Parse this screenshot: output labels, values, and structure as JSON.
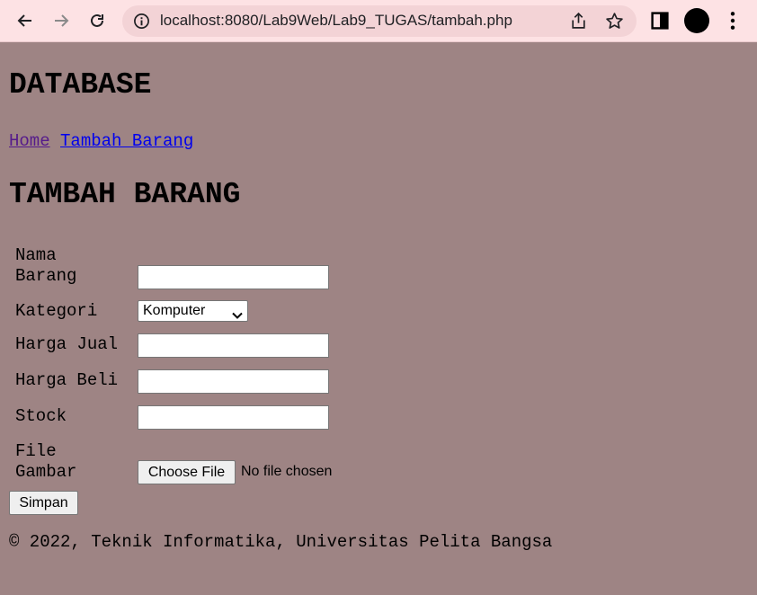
{
  "browser": {
    "url": "localhost:8080/Lab9Web/Lab9_TUGAS/tambah.php"
  },
  "header": {
    "title": "DATABASE"
  },
  "nav": {
    "items": [
      {
        "label": "Home"
      },
      {
        "label": "Tambah Barang"
      }
    ]
  },
  "main": {
    "heading": "TAMBAH BARANG",
    "form": {
      "nama_label_line1": "Nama",
      "nama_label_line2": "Barang",
      "nama_value": "",
      "kategori_label": "Kategori",
      "kategori_selected": "Komputer",
      "harga_jual_label": "Harga Jual",
      "harga_jual_value": "",
      "harga_beli_label": "Harga Beli",
      "harga_beli_value": "",
      "stock_label": "Stock",
      "stock_value": "",
      "gambar_label_line1": "File",
      "gambar_label_line2": "Gambar",
      "file_button_label": "Choose File",
      "file_status": "No file chosen",
      "submit_label": "Simpan"
    }
  },
  "footer": {
    "text": "© 2022, Teknik Informatika, Universitas Pelita Bangsa"
  },
  "colors": {
    "page_background": "#9e8484",
    "chrome_background": "#fde2e4",
    "link": "#0000ee",
    "visited_link": "#551a8b"
  }
}
